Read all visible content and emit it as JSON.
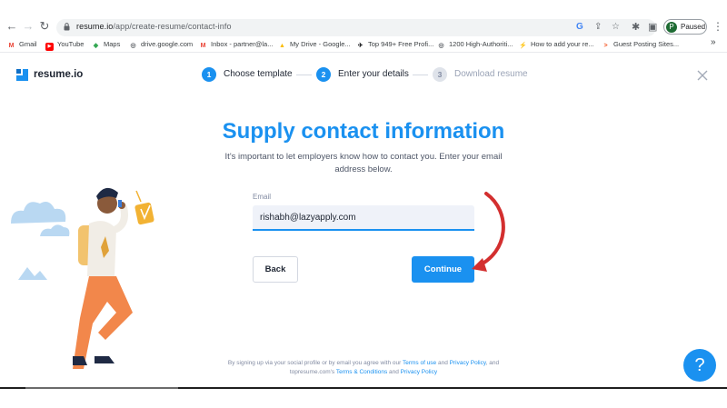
{
  "browser": {
    "url_host": "resume.io",
    "url_path": "/app/create-resume/contact-info",
    "profile_initial": "P",
    "profile_status": "Paused",
    "bookmarks": [
      {
        "label": "Gmail",
        "icon": "gmail-icon",
        "color": "#ea4335"
      },
      {
        "label": "YouTube",
        "icon": "youtube-icon",
        "color": "#ff0000"
      },
      {
        "label": "Maps",
        "icon": "maps-icon",
        "color": "#34a853"
      },
      {
        "label": "drive.google.com",
        "icon": "globe-icon",
        "color": "#5f6368"
      },
      {
        "label": "Inbox - partner@la...",
        "icon": "gmail-icon",
        "color": "#ea4335"
      },
      {
        "label": "My Drive - Google...",
        "icon": "drive-icon",
        "color": "#fbbc04"
      },
      {
        "label": "Top 949+ Free Profi...",
        "icon": "bookmark-icon",
        "color": "#202124"
      },
      {
        "label": "1200 High-Authoriti...",
        "icon": "globe-icon",
        "color": "#5f6368"
      },
      {
        "label": "How to add your re...",
        "icon": "bolt-icon",
        "color": "#34a853"
      },
      {
        "label": "Guest Posting Sites...",
        "icon": "chevron-icon",
        "color": "#f4511e"
      }
    ],
    "more_bookmarks": "»"
  },
  "app": {
    "logo_text": "resume.io",
    "steps": [
      {
        "num": "1",
        "label": "Choose template",
        "state": "active"
      },
      {
        "num": "2",
        "label": "Enter your details",
        "state": "active"
      },
      {
        "num": "3",
        "label": "Download resume",
        "state": "inactive"
      }
    ],
    "title": "Supply contact information",
    "subtitle": "It's important to let employers know how to contact you. Enter your email address below.",
    "email_label": "Email",
    "email_value": "rishabh@lazyapply.com",
    "back_label": "Back",
    "continue_label": "Continue",
    "terms": {
      "part1": "By signing up via your social profile or by email you agree with our ",
      "link1": "Terms of use",
      "part2": " and ",
      "link2": "Privacy Policy",
      "part3": ", and topresume.com's ",
      "link3": "Terms & Conditions",
      "part4": " and ",
      "link4": "Privacy Policy"
    },
    "help_label": "?"
  },
  "colors": {
    "accent": "#1a91f0",
    "annotation_arrow": "#d32f2f",
    "text_dark": "#1e2532"
  }
}
